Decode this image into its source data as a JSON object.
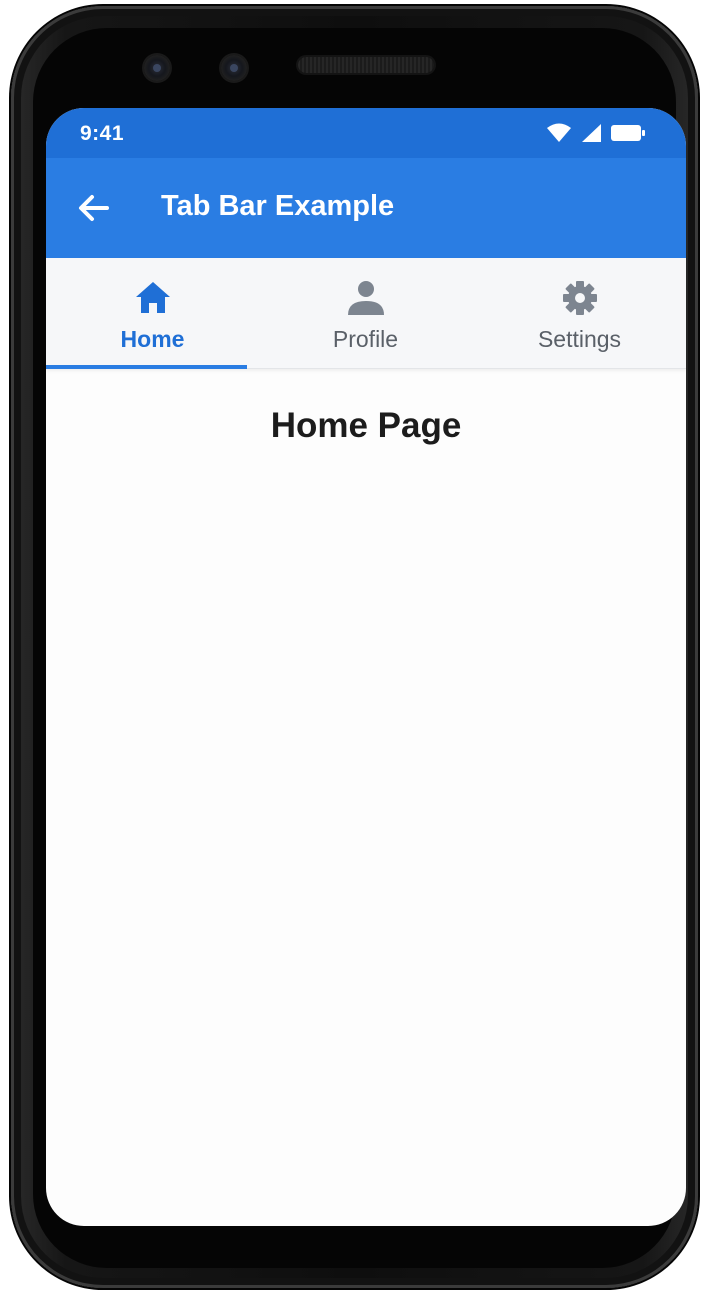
{
  "status_bar": {
    "time": "9:41",
    "icons": [
      "wifi-icon",
      "signal-icon",
      "battery-icon"
    ]
  },
  "app_bar": {
    "back_icon": "arrow-left-icon",
    "title": "Tab Bar Example"
  },
  "tabs": [
    {
      "label": "Home",
      "icon": "home-icon",
      "active": true
    },
    {
      "label": "Profile",
      "icon": "person-icon",
      "active": false
    },
    {
      "label": "Settings",
      "icon": "gear-icon",
      "active": false
    }
  ],
  "content": {
    "heading": "Home Page"
  },
  "colors": {
    "status_bar": "#1f6fd6",
    "app_bar": "#2a7de3",
    "accent": "#2a7de3",
    "tab_inactive": "#5a6068",
    "icon_inactive": "#7d8590"
  }
}
